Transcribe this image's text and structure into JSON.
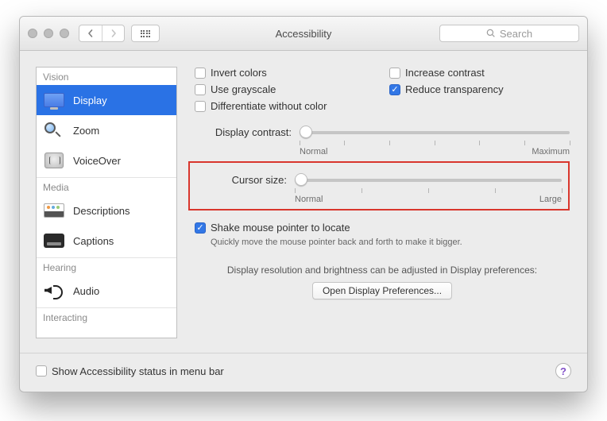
{
  "title": "Accessibility",
  "search": {
    "placeholder": "Search"
  },
  "sidebar": {
    "cats": {
      "vision": "Vision",
      "media": "Media",
      "hearing": "Hearing",
      "interacting": "Interacting"
    },
    "items": {
      "display": "Display",
      "zoom": "Zoom",
      "voiceover": "VoiceOver",
      "descriptions": "Descriptions",
      "captions": "Captions",
      "audio": "Audio"
    }
  },
  "opts": {
    "invert": "Invert colors",
    "grayscale": "Use grayscale",
    "diff": "Differentiate without color",
    "contrast": "Increase contrast",
    "reduce": "Reduce transparency"
  },
  "sliders": {
    "contrast": {
      "label": "Display contrast:",
      "min": "Normal",
      "max": "Maximum"
    },
    "cursor": {
      "label": "Cursor size:",
      "min": "Normal",
      "max": "Large"
    }
  },
  "shake": {
    "label": "Shake mouse pointer to locate",
    "hint": "Quickly move the mouse pointer back and forth to make it bigger."
  },
  "note": "Display resolution and brightness can be adjusted in Display preferences:",
  "open_btn": "Open Display Preferences...",
  "footer_cbx": "Show Accessibility status in menu bar"
}
